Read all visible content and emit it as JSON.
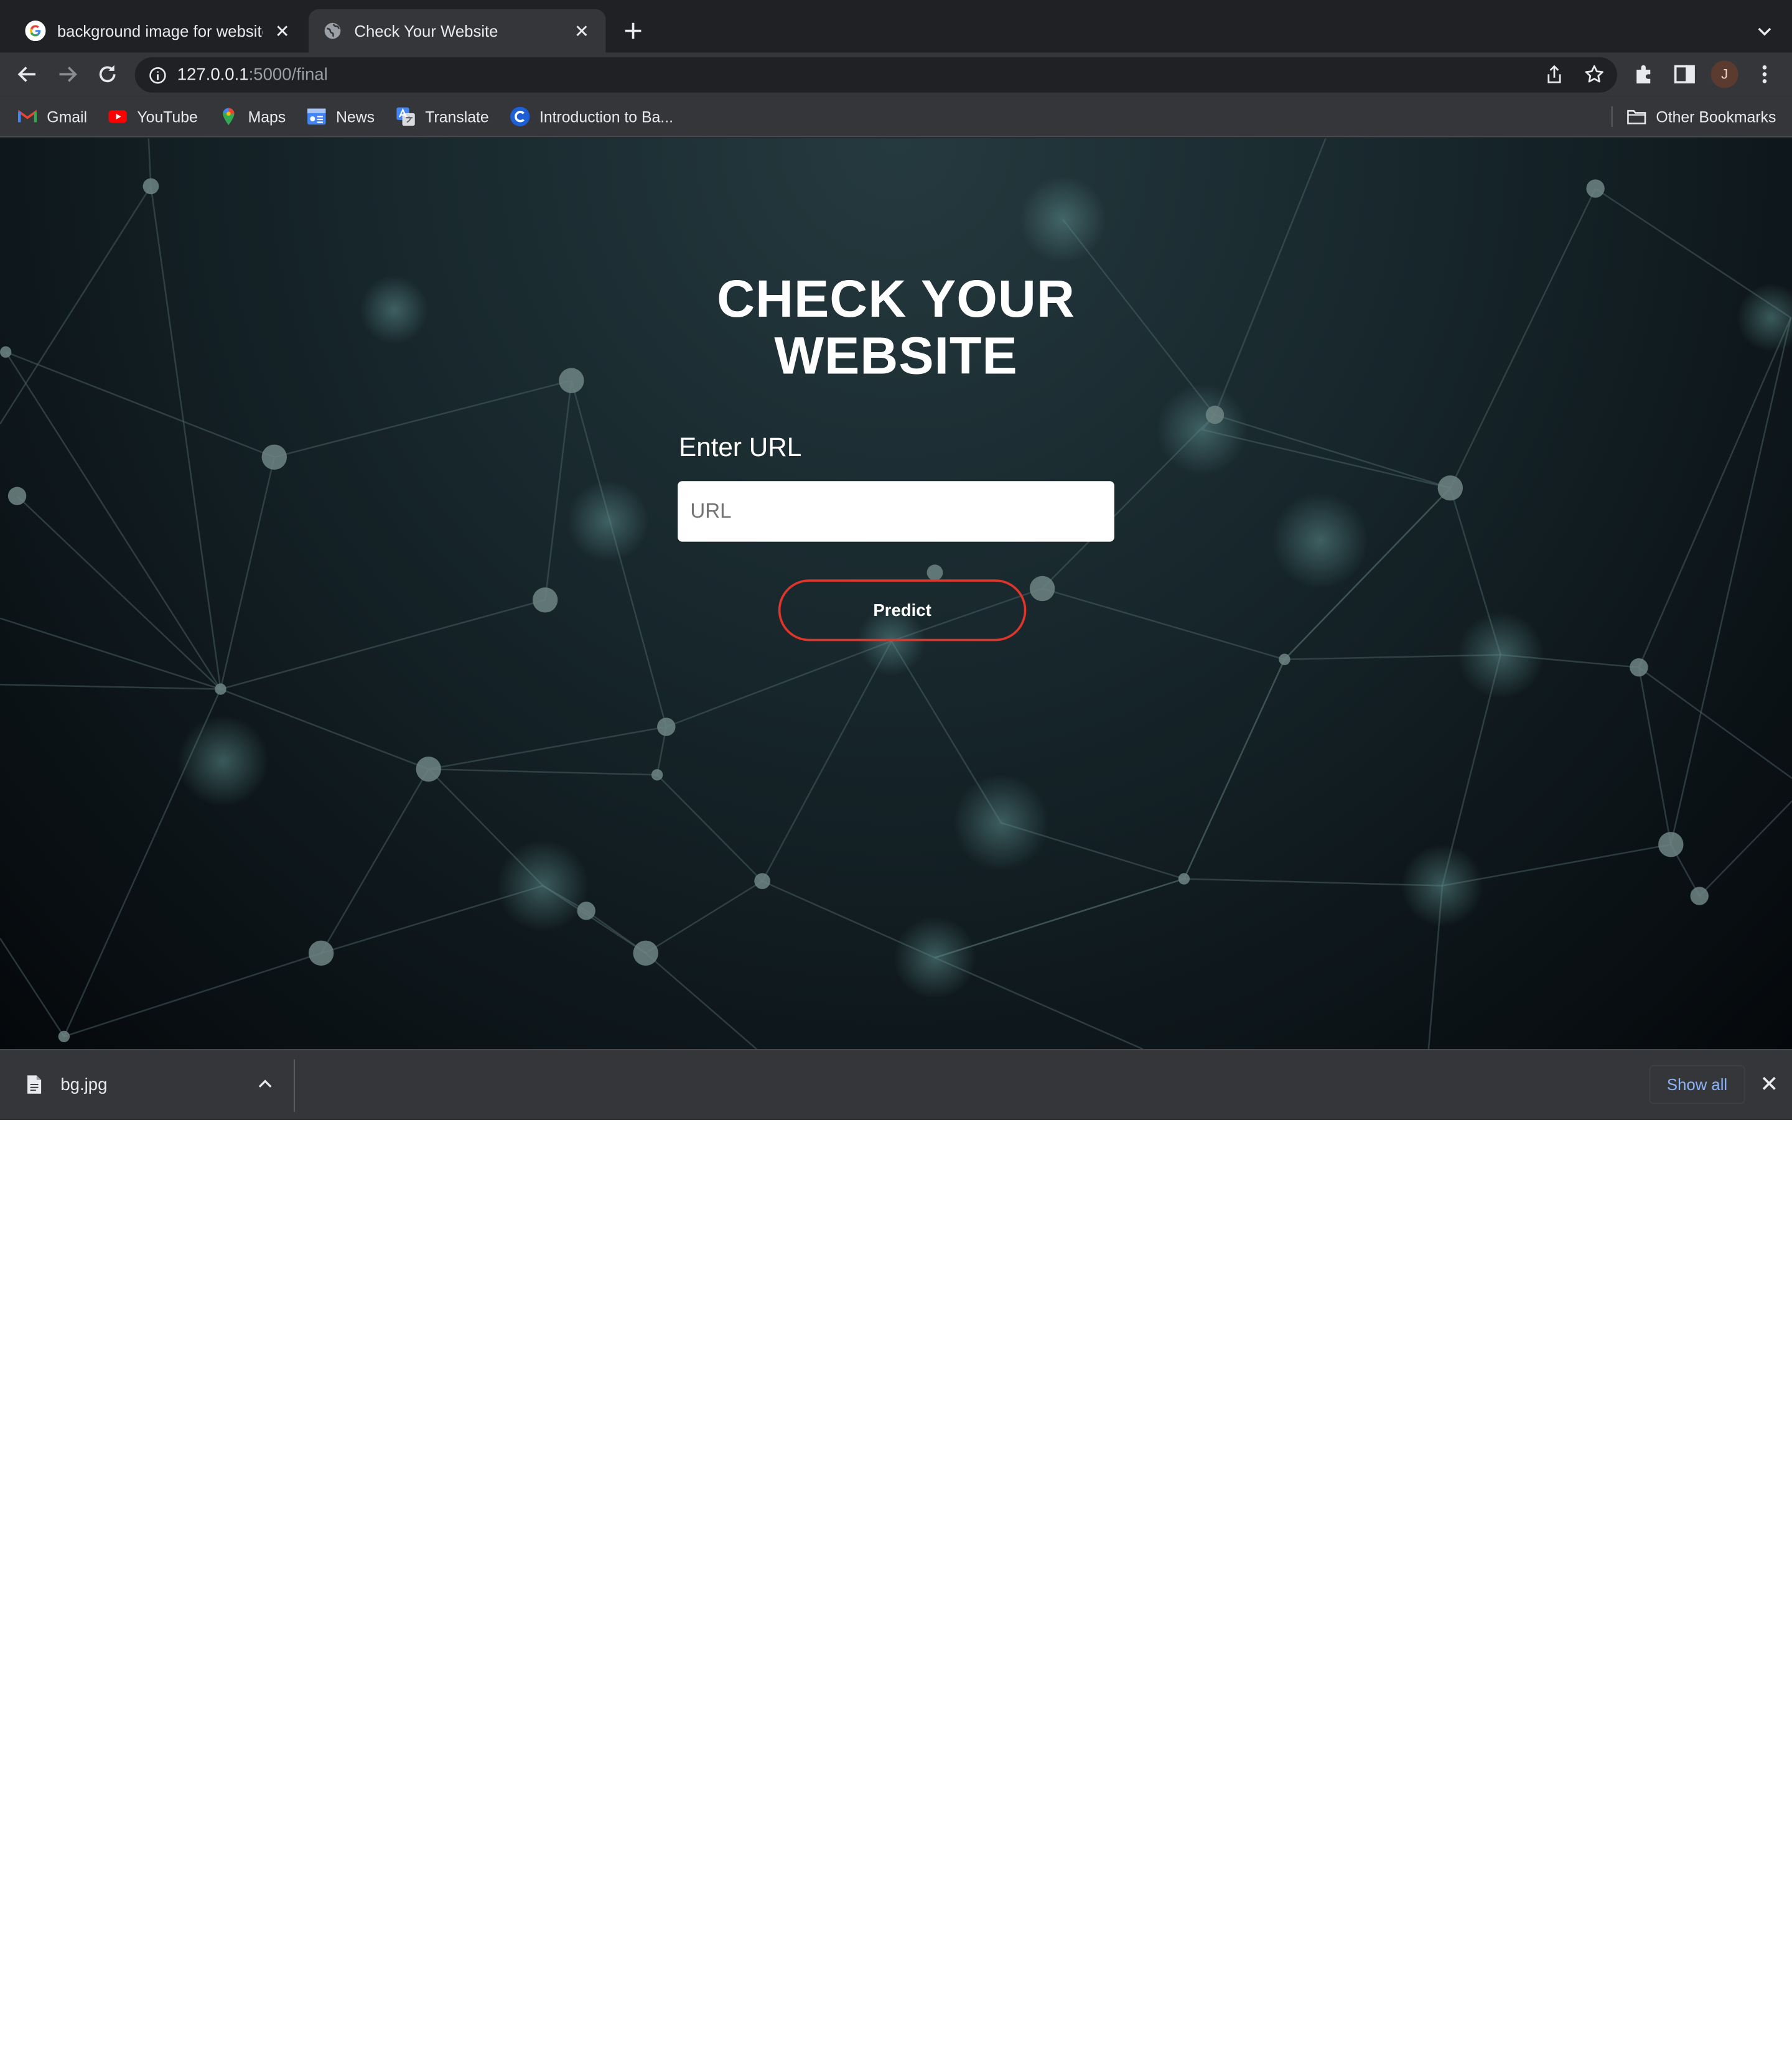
{
  "tabs": [
    {
      "title": "background image for website",
      "favicon": "google-icon",
      "active": false
    },
    {
      "title": "Check Your Website",
      "favicon": "globe-icon",
      "active": true
    }
  ],
  "toolbar": {
    "url_host": "127.0.0.1",
    "url_rest": ":5000/final",
    "profile_initial": "J"
  },
  "bookmarks": [
    {
      "label": "Gmail",
      "icon": "gmail-icon"
    },
    {
      "label": "YouTube",
      "icon": "youtube-icon"
    },
    {
      "label": "Maps",
      "icon": "maps-icon"
    },
    {
      "label": "News",
      "icon": "news-icon"
    },
    {
      "label": "Translate",
      "icon": "translate-icon"
    },
    {
      "label": "Introduction to Ba...",
      "icon": "c-icon"
    }
  ],
  "other_bookmarks": "Other Bookmarks",
  "page": {
    "title_line1": "CHECK YOUR",
    "title_line2": "WEBSITE",
    "input_label": "Enter URL",
    "input_placeholder": "URL",
    "input_value": "",
    "button_label": "Predict",
    "accent_color": "#e0352a"
  },
  "downloads": {
    "file_name": "bg.jpg",
    "show_all": "Show all"
  }
}
